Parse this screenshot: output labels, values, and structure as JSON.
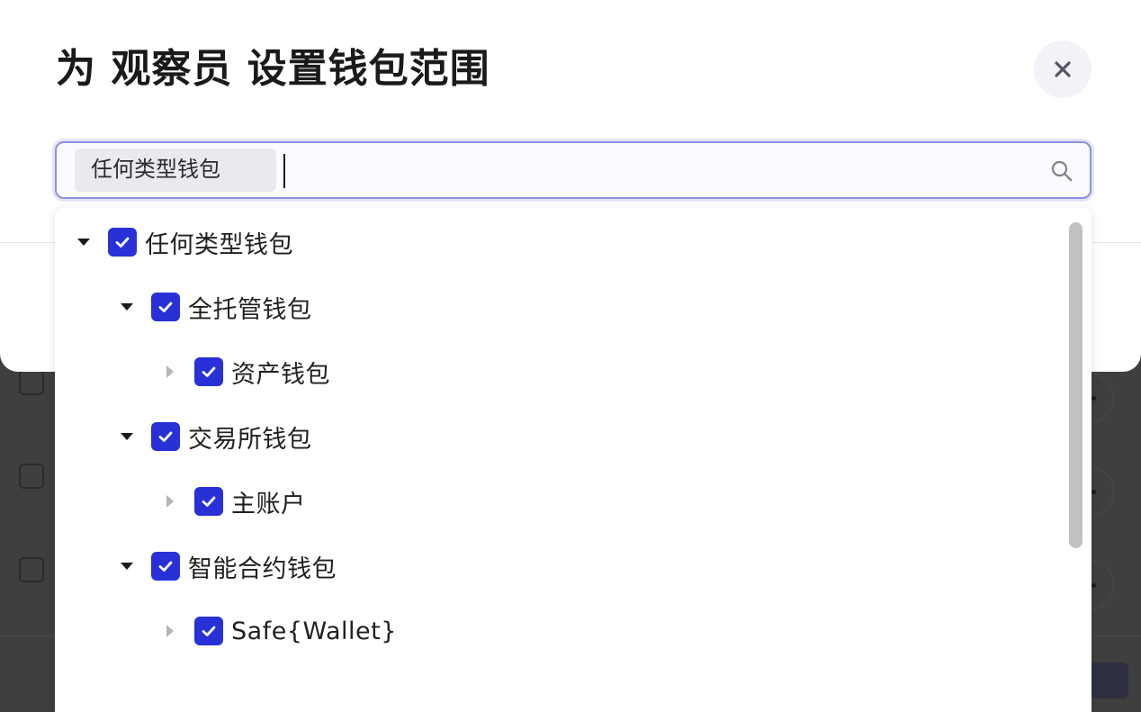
{
  "modal": {
    "title": "为 观察员 设置钱包范围",
    "close_icon": "close-icon"
  },
  "select": {
    "chip_label": "任何类型钱包",
    "input_value": "",
    "search_icon": "search-icon"
  },
  "tree": [
    {
      "label": "任何类型钱包",
      "level": 0,
      "expanded": true,
      "checked": true
    },
    {
      "label": "全托管钱包",
      "level": 1,
      "expanded": true,
      "checked": true
    },
    {
      "label": "资产钱包",
      "level": 2,
      "expanded": false,
      "checked": true
    },
    {
      "label": "交易所钱包",
      "level": 1,
      "expanded": true,
      "checked": true
    },
    {
      "label": "主账户",
      "level": 2,
      "expanded": false,
      "checked": true
    },
    {
      "label": "智能合约钱包",
      "level": 1,
      "expanded": true,
      "checked": true
    },
    {
      "label": "Safe{Wallet}",
      "level": 2,
      "expanded": false,
      "checked": true
    }
  ],
  "colors": {
    "checkbox": "#2731d6",
    "focus_border": "#8d8fe0",
    "overlay": "#3f3f3f"
  }
}
